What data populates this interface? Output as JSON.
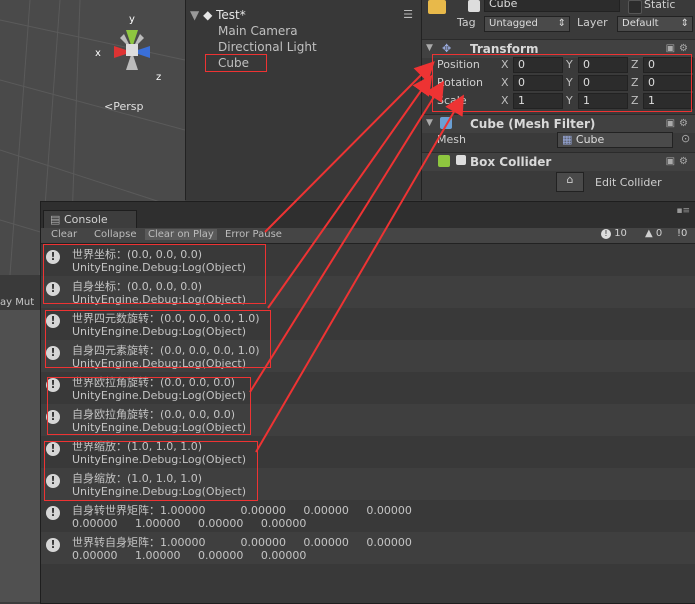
{
  "scene": {
    "projection_label": "Persp",
    "axes": [
      "x",
      "y",
      "z"
    ]
  },
  "hierarchy": {
    "scene_name": "Test*",
    "items": [
      "Main Camera",
      "Directional Light",
      "Cube"
    ]
  },
  "inspector": {
    "object_name": "Cube",
    "static_label": "Static",
    "tag_label": "Tag",
    "tag_value": "Untagged",
    "layer_label": "Layer",
    "layer_value": "Default",
    "transform": {
      "title": "Transform",
      "position": {
        "label": "Position",
        "x": "0",
        "y": "0",
        "z": "0"
      },
      "rotation": {
        "label": "Rotation",
        "x": "0",
        "y": "0",
        "z": "0"
      },
      "scale": {
        "label": "Scale",
        "x": "1",
        "y": "1",
        "z": "1"
      },
      "x_label": "X",
      "y_label": "Y",
      "z_label": "Z"
    },
    "mesh_filter": {
      "title": "Cube (Mesh Filter)",
      "mesh_label": "Mesh",
      "mesh_value": "Cube"
    },
    "box_collider": {
      "title": "Box Collider",
      "edit_label": "Edit Collider"
    }
  },
  "left_strip": {
    "text": "ay  Mut"
  },
  "console": {
    "tab": "Console",
    "toolbar": [
      "Clear",
      "Collapse",
      "Clear on Play",
      "Error Pause"
    ],
    "counts": {
      "info": "10",
      "warn": "0",
      "error": "0"
    },
    "logs": [
      {
        "l1": "世界坐标：(0.0, 0.0, 0.0)",
        "l2": "UnityEngine.Debug:Log(Object)"
      },
      {
        "l1": "自身坐标：(0.0, 0.0, 0.0)",
        "l2": "UnityEngine.Debug:Log(Object)"
      },
      {
        "l1": "世界四元数旋转：(0.0, 0.0, 0.0, 1.0)",
        "l2": "UnityEngine.Debug:Log(Object)"
      },
      {
        "l1": "自身四元素旋转：(0.0, 0.0, 0.0, 1.0)",
        "l2": "UnityEngine.Debug:Log(Object)"
      },
      {
        "l1": "世界欧拉角旋转：(0.0, 0.0, 0.0)",
        "l2": "UnityEngine.Debug:Log(Object)"
      },
      {
        "l1": "自身欧拉角旋转：(0.0, 0.0, 0.0)",
        "l2": "UnityEngine.Debug:Log(Object)"
      },
      {
        "l1": "世界缩放：(1.0, 1.0, 1.0)",
        "l2": "UnityEngine.Debug:Log(Object)"
      },
      {
        "l1": "自身缩放：(1.0, 1.0, 1.0)",
        "l2": "UnityEngine.Debug:Log(Object)"
      },
      {
        "l1": "自身转世界矩阵：1.00000          0.00000     0.00000     0.00000",
        "l2": "0.00000     1.00000     0.00000     0.00000"
      },
      {
        "l1": "世界转自身矩阵：1.00000          0.00000     0.00000     0.00000",
        "l2": "0.00000     1.00000     0.00000     0.00000"
      }
    ]
  },
  "colors": {
    "annotation_red": "#e33333",
    "console_bg": "#393939"
  }
}
